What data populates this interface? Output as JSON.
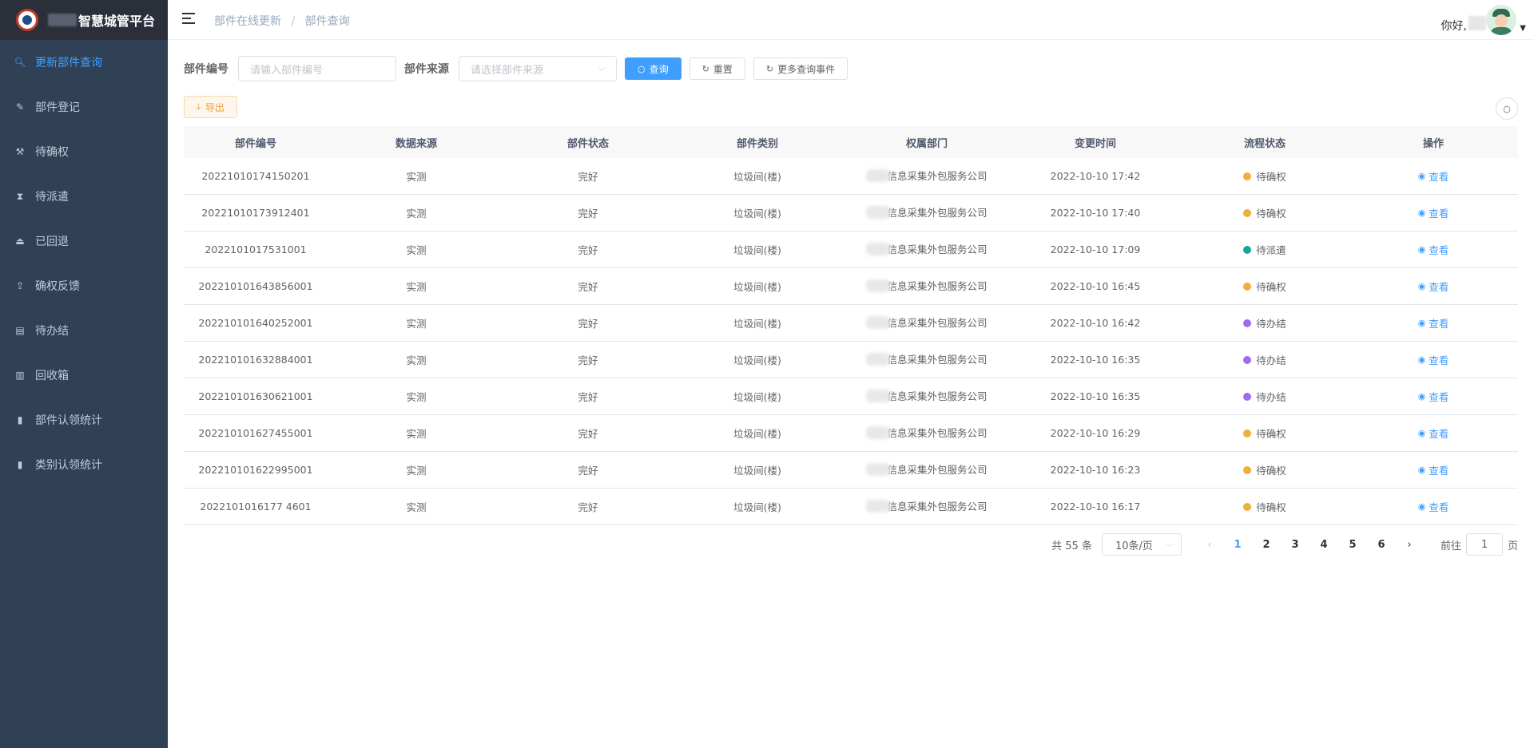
{
  "brand": {
    "title": "智慧城管平台"
  },
  "sidebar": {
    "items": [
      {
        "label": "更新部件查询",
        "icon": "search-icon",
        "glyph": "🔍︎",
        "active": true
      },
      {
        "label": "部件登记",
        "icon": "edit-icon",
        "glyph": "✎",
        "active": false
      },
      {
        "label": "待确权",
        "icon": "hammer-icon",
        "glyph": "⚒",
        "active": false
      },
      {
        "label": "待派遣",
        "icon": "hourglass-icon",
        "glyph": "⧗",
        "active": false
      },
      {
        "label": "已回退",
        "icon": "eject-icon",
        "glyph": "⏏",
        "active": false
      },
      {
        "label": "确权反馈",
        "icon": "upload-icon",
        "glyph": "⇪",
        "active": false
      },
      {
        "label": "待办结",
        "icon": "document-icon",
        "glyph": "▤",
        "active": false
      },
      {
        "label": "回收箱",
        "icon": "trash-icon",
        "glyph": "▥",
        "active": false
      },
      {
        "label": "部件认领统计",
        "icon": "bar-chart-icon",
        "glyph": "▮",
        "active": false
      },
      {
        "label": "类别认领统计",
        "icon": "bar-chart-icon",
        "glyph": "▮",
        "active": false
      }
    ]
  },
  "header": {
    "breadcrumb": [
      "部件在线更新",
      "部件查询"
    ],
    "greeting": "你好,"
  },
  "search": {
    "code_label": "部件编号",
    "code_placeholder": "请输入部件编号",
    "source_label": "部件来源",
    "source_placeholder": "请选择部件来源",
    "query_button": "查询",
    "reset_button": "重置",
    "more_button": "更多查询事件"
  },
  "toolbar": {
    "export_button": "导出"
  },
  "table": {
    "columns": [
      "部件编号",
      "数据来源",
      "部件状态",
      "部件类别",
      "权属部门",
      "变更时间",
      "流程状态",
      "操作"
    ],
    "rows": [
      {
        "code": "20221010174150201",
        "source": "实测",
        "state": "完好",
        "category": "垃圾间(楼)",
        "dept": "信息采集外包服务公司",
        "time": "2022-10-10 17:42",
        "flow": "待确权",
        "flow_color": "#f0ad3a",
        "action": "查看"
      },
      {
        "code": "20221010173912401",
        "source": "实测",
        "state": "完好",
        "category": "垃圾间(楼)",
        "dept": "信息采集外包服务公司",
        "time": "2022-10-10 17:40",
        "flow": "待确权",
        "flow_color": "#f0ad3a",
        "action": "查看"
      },
      {
        "code": "2022101017531001",
        "source": "实测",
        "state": "完好",
        "category": "垃圾间(楼)",
        "dept": "信息采集外包服务公司",
        "time": "2022-10-10 17:09",
        "flow": "待派遣",
        "flow_color": "#1aa39a",
        "action": "查看"
      },
      {
        "code": "202210101643856001",
        "source": "实测",
        "state": "完好",
        "category": "垃圾间(楼)",
        "dept": "信息采集外包服务公司",
        "time": "2022-10-10 16:45",
        "flow": "待确权",
        "flow_color": "#f0ad3a",
        "action": "查看"
      },
      {
        "code": "202210101640252001",
        "source": "实测",
        "state": "完好",
        "category": "垃圾间(楼)",
        "dept": "信息采集外包服务公司",
        "time": "2022-10-10 16:42",
        "flow": "待办结",
        "flow_color": "#9c6cf0",
        "action": "查看"
      },
      {
        "code": "202210101632884001",
        "source": "实测",
        "state": "完好",
        "category": "垃圾间(楼)",
        "dept": "信息采集外包服务公司",
        "time": "2022-10-10 16:35",
        "flow": "待办结",
        "flow_color": "#9c6cf0",
        "action": "查看"
      },
      {
        "code": "202210101630621001",
        "source": "实测",
        "state": "完好",
        "category": "垃圾间(楼)",
        "dept": "信息采集外包服务公司",
        "time": "2022-10-10 16:35",
        "flow": "待办结",
        "flow_color": "#9c6cf0",
        "action": "查看"
      },
      {
        "code": "202210101627455001",
        "source": "实测",
        "state": "完好",
        "category": "垃圾间(楼)",
        "dept": "信息采集外包服务公司",
        "time": "2022-10-10 16:29",
        "flow": "待确权",
        "flow_color": "#f0ad3a",
        "action": "查看"
      },
      {
        "code": "202210101622995001",
        "source": "实测",
        "state": "完好",
        "category": "垃圾间(楼)",
        "dept": "信息采集外包服务公司",
        "time": "2022-10-10 16:23",
        "flow": "待确权",
        "flow_color": "#f0ad3a",
        "action": "查看"
      },
      {
        "code": "2022101016177 4601",
        "source": "实测",
        "state": "完好",
        "category": "垃圾间(楼)",
        "dept": "信息采集外包服务公司",
        "time": "2022-10-10 16:17",
        "flow": "待确权",
        "flow_color": "#f0ad3a",
        "action": "查看"
      }
    ]
  },
  "pagination": {
    "total_text": "共 55 条",
    "page_size": "10条/页",
    "pages": [
      "1",
      "2",
      "3",
      "4",
      "5",
      "6"
    ],
    "current": "1",
    "goto_label": "前往",
    "goto_value": "1",
    "goto_suffix": "页"
  },
  "colors": {
    "accent": "#409eff",
    "sidebar_bg": "#304156",
    "warning": "#e6a23c"
  }
}
